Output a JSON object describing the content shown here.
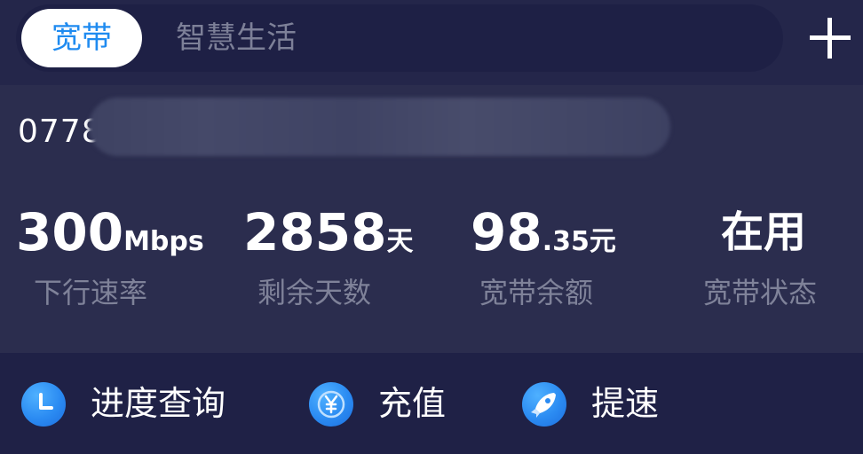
{
  "tabs": [
    {
      "label": "宽带",
      "active": true
    },
    {
      "label": "智慧生活",
      "active": false
    }
  ],
  "header": {
    "add_icon": "plus-icon"
  },
  "account": {
    "number": "0778"
  },
  "stats": [
    {
      "value": "300",
      "unit": "Mbps",
      "label": "下行速率"
    },
    {
      "value": "2858",
      "unit": "天",
      "label": "剩余天数"
    },
    {
      "value_int": "98",
      "value_dec": ".35",
      "unit": "元",
      "label": "宽带余额"
    },
    {
      "value": "在用",
      "label": "宽带状态"
    }
  ],
  "actions": [
    {
      "label": "进度查询",
      "icon": "clock-icon"
    },
    {
      "label": "充值",
      "icon": "yuan-icon"
    },
    {
      "label": "提速",
      "icon": "rocket-icon"
    }
  ],
  "colors": {
    "background": "#2b2d4e",
    "tab_active_text": "#1f8bf0",
    "muted_text": "#7f8299",
    "icon_blue": "#2b8bf2"
  }
}
